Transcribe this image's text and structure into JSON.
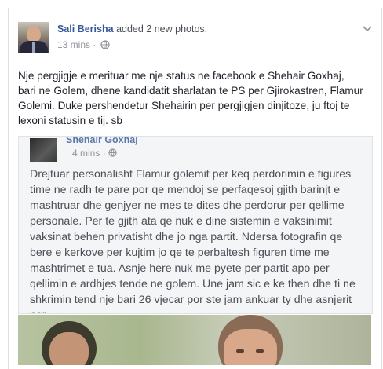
{
  "post": {
    "author": "Sali Berisha",
    "action": "added 2 new photos.",
    "timestamp": "13 mins",
    "separator": "·",
    "status": "Nje pergjigje e merituar me nje status ne facebook e Shehair Goxhaj, bari ne Golem, dhene kandidatit sharlatan te PS per Gjirokastren, Flamur Golemi. Duke pershendetur Shehairin per pergjigjen dinjitoze, ju ftoj te lexoni statusin e tij. sb"
  },
  "embedded_screenshot": {
    "name": "Shehair Goxhaj",
    "timestamp": "4 mins",
    "separator": "·",
    "text": "Drejtuar personalisht Flamur golemit per keq perdorimin e figures time ne radh te pare por qe mendoj se perfaqesoj gjith barinjt e mashtruar dhe genjyer ne mes te dites dhe perdorur per qellime personale. Per te gjith ata qe nuk e dine sistemin e vaksinimit vaksinat behen privatisht dhe jo nga partit. Ndersa fotografin qe bere e kerkove per kujtim jo qe te perbaltesh figuren time me mashtrimet e tua. Asnje here nuk me pyete per partit apo per qellimin e ardhjes tende  ne golem. Une jam sic e ke then dhe ti ne shkrimin tend nje bari 26 vjecar por ste jam ankuar ty dhe asnjerit per"
  },
  "icons": {
    "globe": "globe-icon",
    "menu": "chevron-down-icon"
  },
  "colors": {
    "author": "#365899",
    "meta": "#90949c",
    "text": "#1d2129"
  }
}
